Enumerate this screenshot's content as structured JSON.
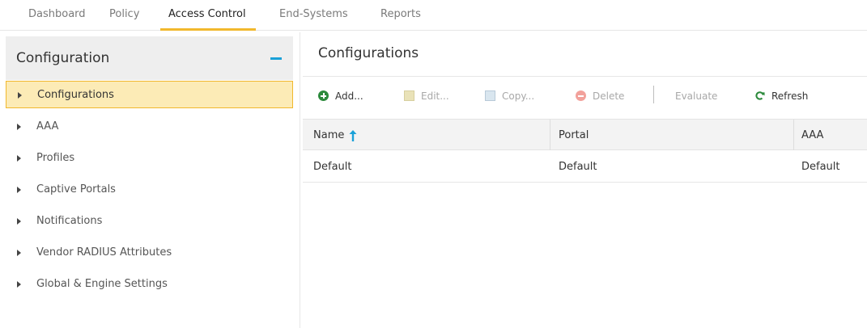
{
  "topnav": {
    "tabs": [
      {
        "label": "Dashboard",
        "active": false
      },
      {
        "label": "Policy",
        "active": false
      },
      {
        "label": "Access Control",
        "active": true
      },
      {
        "label": "End-Systems",
        "active": false
      },
      {
        "label": "Reports",
        "active": false
      }
    ]
  },
  "sidebar": {
    "title": "Configuration",
    "items": [
      {
        "label": "Configurations",
        "selected": true
      },
      {
        "label": "AAA",
        "selected": false
      },
      {
        "label": "Profiles",
        "selected": false
      },
      {
        "label": "Captive Portals",
        "selected": false
      },
      {
        "label": "Notifications",
        "selected": false
      },
      {
        "label": "Vendor RADIUS Attributes",
        "selected": false
      },
      {
        "label": "Global & Engine Settings",
        "selected": false
      }
    ]
  },
  "main": {
    "title": "Configurations",
    "toolbar": {
      "add": "Add...",
      "edit": "Edit...",
      "copy": "Copy...",
      "delete": "Delete",
      "evaluate": "Evaluate",
      "refresh": "Refresh"
    },
    "table": {
      "columns": [
        "Name",
        "Portal",
        "AAA"
      ],
      "sort_column": "Name",
      "sort_direction": "ascending",
      "rows": [
        [
          "Default",
          "Default",
          "Default"
        ]
      ]
    }
  },
  "colors": {
    "accent_tab": "#f1b82d",
    "selected_bg": "#fcebb6",
    "collapse_icon": "#1aa1d8",
    "add_icon": "#2c8a3c",
    "refresh_icon": "#2c8a3c",
    "sort_icon": "#1aa1d8"
  }
}
